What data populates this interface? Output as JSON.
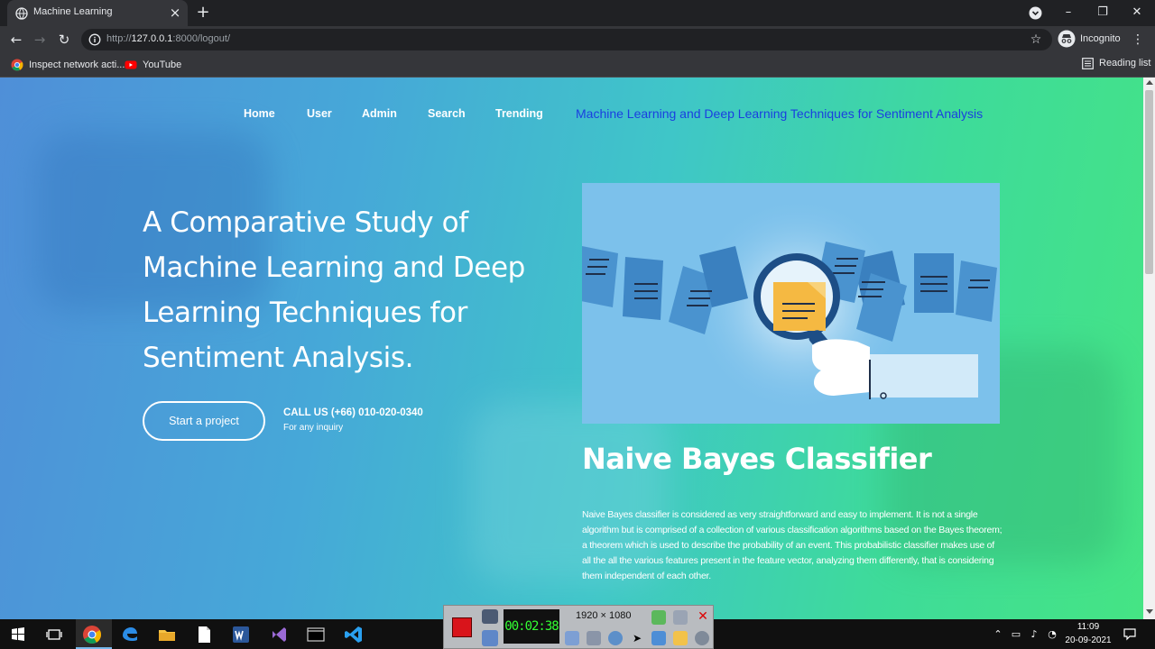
{
  "browser": {
    "tab_title": "Machine Learning",
    "url_scheme": "http://",
    "url_host": "127.0.0.1",
    "url_rest": ":8000/logout/",
    "incognito_label": "Incognito",
    "bookmarks": [
      "Inspect network acti...",
      "YouTube"
    ],
    "reading_list": "Reading list"
  },
  "nav": {
    "links": [
      "Home",
      "User",
      "Admin",
      "Search",
      "Trending"
    ],
    "brand": "Machine Learning and Deep Learning Techniques for Sentiment Analysis"
  },
  "hero": {
    "title": "A Comparative Study of Machine Learning and Deep Learning Techniques for Sentiment Analysis.",
    "cta": "Start a project",
    "call_us": "CALL US (+66) 010-020-0340",
    "inquiry": "For any inquiry"
  },
  "section": {
    "title": "Naive Bayes Classifier",
    "text": "Naive Bayes classifier is considered as very straightforward and easy to implement. It is not a single algorithm but is comprised of a collection of various classification algorithms based on the Bayes theorem; a theorem which is used to describe the probability of an event. This probabilistic classifier makes use of all the all the various features present in the feature vector, analyzing them differently, that is considering them independent of each other."
  },
  "recorder": {
    "timer": "00:02:38",
    "resolution": "1920 × 1080"
  },
  "taskbar": {
    "time": "11:09",
    "date": "20-09-2021"
  },
  "colors": {
    "brand_link": "#1a3fe0",
    "gradient_left": "#4f8fd8",
    "gradient_right": "#45e484",
    "chrome_dark": "#202124",
    "chrome_toolbar": "#35363a"
  }
}
